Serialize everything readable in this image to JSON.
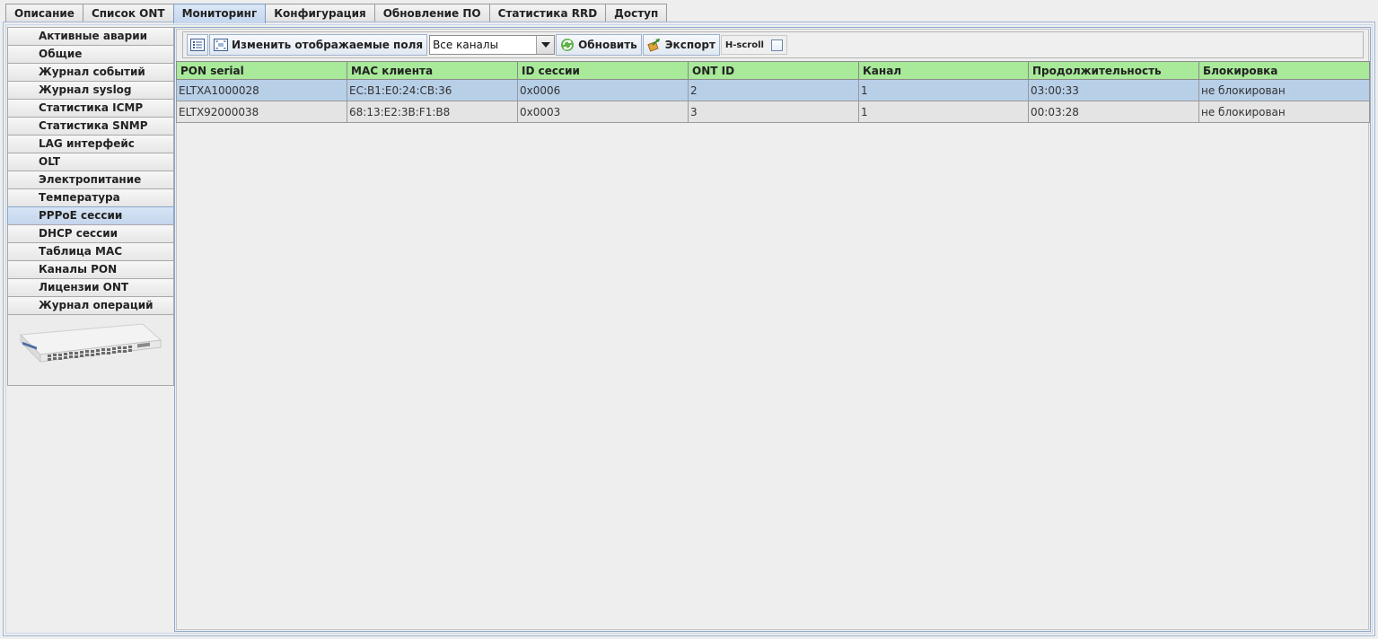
{
  "top_tabs": [
    {
      "label": "Описание"
    },
    {
      "label": "Список ONT"
    },
    {
      "label": "Мониторинг",
      "active": true
    },
    {
      "label": "Конфигурация"
    },
    {
      "label": "Обновление ПО"
    },
    {
      "label": "Статистика RRD"
    },
    {
      "label": "Доступ"
    }
  ],
  "side_tabs": [
    {
      "label": "Активные аварии"
    },
    {
      "label": "Общие"
    },
    {
      "label": "Журнал событий"
    },
    {
      "label": "Журнал syslog"
    },
    {
      "label": "Статистика ICMP"
    },
    {
      "label": "Статистика SNMP"
    },
    {
      "label": "LAG интерфейс"
    },
    {
      "label": "OLT"
    },
    {
      "label": "Электропитание"
    },
    {
      "label": "Температура"
    },
    {
      "label": "PPPoE сессии",
      "active": true
    },
    {
      "label": "DHCP сессии"
    },
    {
      "label": "Таблица MAC"
    },
    {
      "label": "Каналы PON"
    },
    {
      "label": "Лицензии ONT"
    },
    {
      "label": "Журнал операций"
    }
  ],
  "toolbar": {
    "change_fields_label": "Изменить отображаемые поля",
    "channel_select_value": "Все каналы",
    "refresh_label": "Обновить",
    "export_label": "Экспорт",
    "hscroll_label": "H-scroll",
    "hscroll_checked": false
  },
  "table": {
    "columns": [
      "PON serial",
      "MAC клиента",
      "ID сессии",
      "ONT ID",
      "Канал",
      "Продолжительность",
      "Блокировка"
    ],
    "rows": [
      [
        "ELTXA1000028",
        "EC:B1:E0:24:CB:36",
        "0x0006",
        "2",
        "1",
        "03:00:33",
        "не блокирован"
      ],
      [
        "ELTX92000038",
        "68:13:E2:3B:F1:B8",
        "0x0003",
        "3",
        "1",
        "00:03:28",
        "не блокирован"
      ]
    ],
    "selected_row": 0
  },
  "colors": {
    "header_bg": "#a8e99a",
    "selected_row_bg": "#b8cfe8",
    "row_bg": "#e4e4e4"
  },
  "icons": {
    "columns_toggle": "list-settings-icon",
    "change_fields": "fields-icon",
    "refresh": "refresh-icon",
    "export": "export-icon",
    "device_image": "olt-device-image"
  }
}
